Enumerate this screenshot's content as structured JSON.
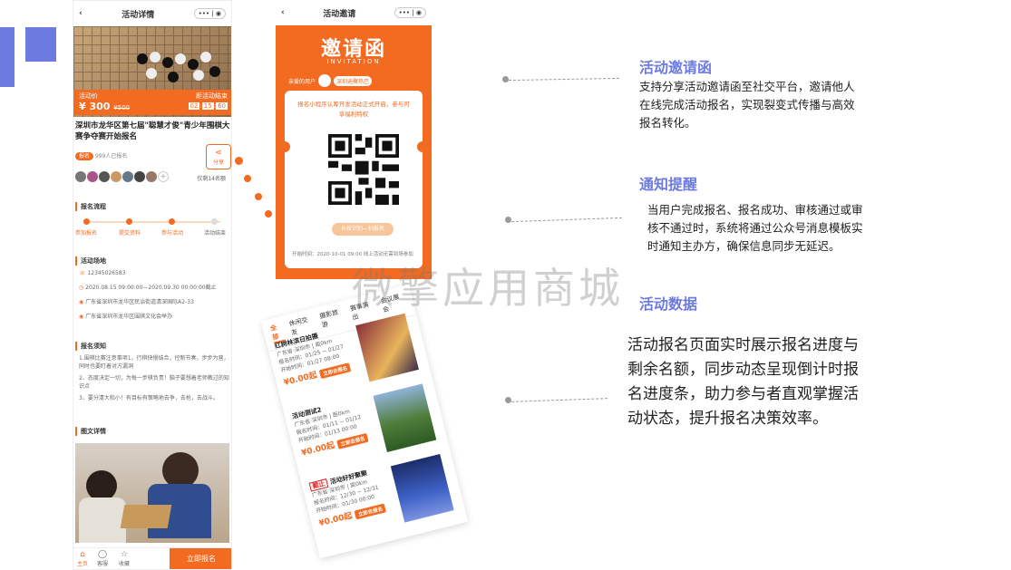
{
  "phone1": {
    "nav_title": "活动详情",
    "capsule": "••• | ◉",
    "price_label": "活动价",
    "price": "¥ 300",
    "original_price": "¥500",
    "countdown_label": "距活动结束",
    "countdown": [
      "02",
      "15",
      "60"
    ],
    "event_title": "深圳市龙华区第七届\"聪慧才俊\"青少年围棋大赛争夺赛开始报名",
    "signup_badge": "报名",
    "signup_count": "999人已报名",
    "share_label": "分享",
    "quota_left": "仅剩14名额",
    "process_title": "报名流程",
    "steps": [
      "参加报名",
      "提交资料",
      "参与活动",
      "活动结束"
    ],
    "venue_title": "活动场地",
    "phone": "12345026583",
    "time": "2020.08.15 09:00:00—2020.09.30 00:00:00截止",
    "address1": "广东省深圳市龙华区民治街道清深国际A2-33",
    "address2": "广东省深圳市龙华区围棋文化会举办",
    "notes_title": "报名须知",
    "notes": [
      "1.围棋比赛注意事项1，行棋快慢结合，控制节奏，步步为营，同时也要盯着对方漏洞",
      "2、态度决定一切，为每一步棋负责！脑子要想着老师教过的知识点",
      "3、要分清大和小！有目标有策略地去争，去抢，去战斗。"
    ],
    "details_title": "图文详情",
    "bottom_nav": [
      "主页",
      "客服",
      "收藏"
    ],
    "apply": "立即报名"
  },
  "phone2": {
    "nav_title": "活动邀请",
    "capsule": "••• | ◉",
    "title": "邀请函",
    "subtitle": "INVITATION",
    "greeting": "亲爱的用户",
    "user": "深圳迪聚热巴",
    "desc": "报名小程序认筹开发活动正式开启，参与可享福利特权",
    "cta": "长按识别—扫报名",
    "footer": "开始时间：2020-10-01 09:00   线上活动无需到场参加"
  },
  "phone3": {
    "tabs": [
      "全部",
      "休闲交友",
      "摄影旅游",
      "赛事演出",
      "会议展会"
    ],
    "events": [
      {
        "title": "红树林滨日拍摄",
        "loc": "广东省·深圳市 | 距0km",
        "signup": "报名时间：01/25 ~ 01/27",
        "open": "开始时间：01/27 08:00",
        "price": "¥0.00起",
        "btn": "立即去报名"
      },
      {
        "title": "活动测试2",
        "loc": "广东省·深圳市 | 距0km",
        "signup": "报名时间：01/11 ~ 01/12",
        "open": "开始时间：01/13 00:00",
        "price": "¥0.00起",
        "btn": "立即去报名"
      },
      {
        "title": "活动好好聚聚",
        "loc": "广东省·深圳市 | 距0km",
        "signup": "报名时间：12/30 ~ 12/31",
        "open": "开始时间：01/30 00:00",
        "price": "¥0.00起",
        "btn": "立即去报名"
      }
    ],
    "ended_badge": "截止"
  },
  "features": [
    {
      "title": "活动邀请函",
      "body": [
        "支持分享活动邀请函至社交平台，邀请他人",
        "在线完成活动报名，实现裂变式传播与高效",
        "报名转化。"
      ]
    },
    {
      "title": "通知提醒",
      "body": [
        "当用户完成报名、报名成功、审核通过或审",
        "核不通过时，系统将通过公众号消息模板实",
        "时通知主办方，确保信息同步无延迟。"
      ]
    },
    {
      "title": "活动数据",
      "body": [
        "活动报名页面实时展示报名进度与",
        "剩余名额，同步动态呈现倒计时报",
        "名进度条，助力参与者直观掌握活",
        "动状态，提升报名决策效率。"
      ]
    }
  ],
  "watermark": "微擎应用商城",
  "colors": {
    "accent": "#f26b21",
    "heading": "#6d7be0"
  }
}
